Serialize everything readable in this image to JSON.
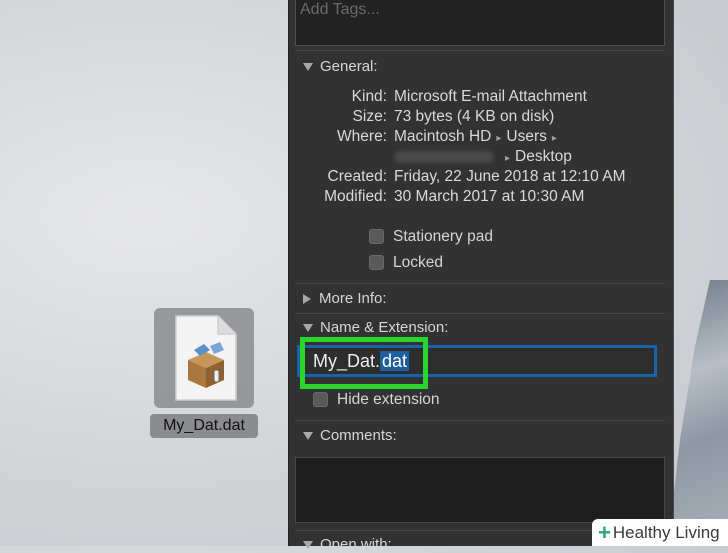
{
  "tags": {
    "placeholder": "Add Tags..."
  },
  "general": {
    "header": "General:",
    "kind_label": "Kind:",
    "kind_value": "Microsoft E-mail Attachment",
    "size_label": "Size:",
    "size_value": "73 bytes (4 KB on disk)",
    "where_label": "Where:",
    "where_value_1": "Macintosh HD",
    "where_value_2": "Users",
    "where_value_3": "Desktop",
    "created_label": "Created:",
    "created_value": "Friday, 22 June 2018 at 12:10 AM",
    "modified_label": "Modified:",
    "modified_value": "30 March 2017 at 10:30 AM",
    "stationery_label": "Stationery pad",
    "locked_label": "Locked"
  },
  "more_info": {
    "header": "More Info:"
  },
  "name_ext": {
    "header": "Name & Extension:",
    "name_base": "My_Dat.",
    "name_ext_selected": "dat",
    "hide_ext_label": "Hide extension"
  },
  "comments": {
    "header": "Comments:"
  },
  "open_with": {
    "header": "Open with:"
  },
  "desktop_icon": {
    "label": "My_Dat.dat"
  },
  "watermark": {
    "plus": "+",
    "text": "Healthy Living"
  },
  "colors": {
    "panel_bg": "#323232",
    "highlight_green": "#2bd52b",
    "selection_blue": "#1d5f9e"
  }
}
